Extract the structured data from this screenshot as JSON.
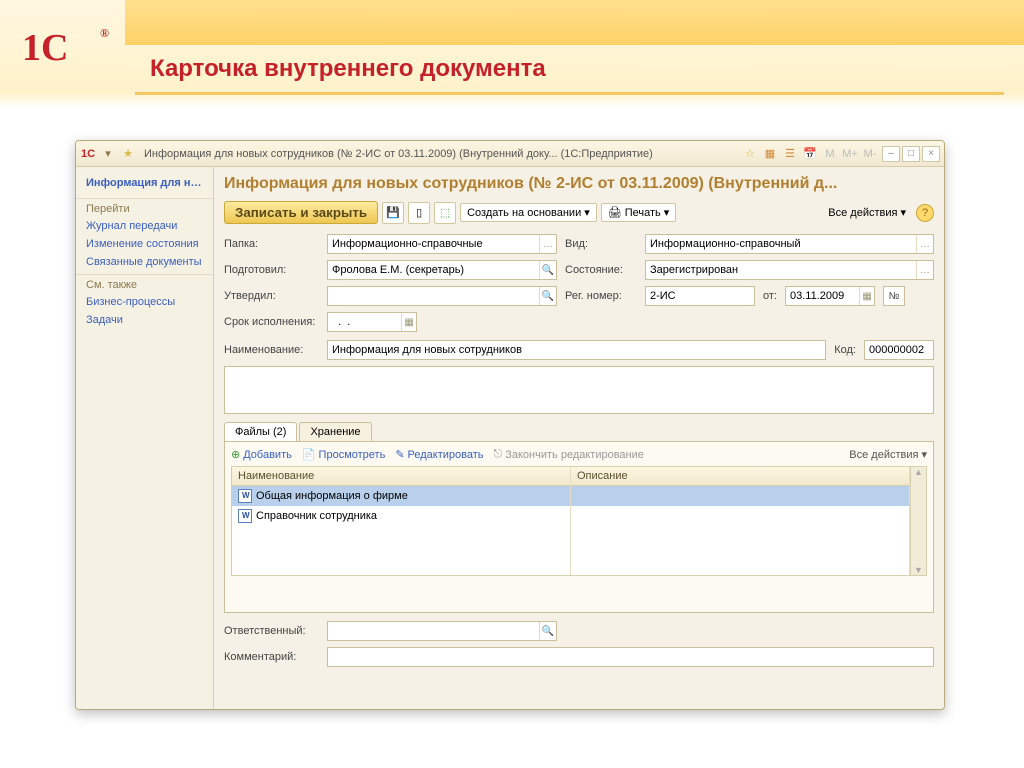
{
  "slide": {
    "title": "Карточка внутреннего документа",
    "logo_text": "1С"
  },
  "titlebar": {
    "text": "Информация для новых сотрудников (№ 2-ИС от 03.11.2009) (Внутренний доку...   (1С:Предприятие)",
    "ctrls": {
      "m": "M",
      "mplus": "M+",
      "mminus": "M-"
    }
  },
  "nav": {
    "title": "Информация для нов…",
    "section1": "Перейти",
    "links1": [
      "Журнал передачи",
      "Изменение состояния",
      "Связанные документы"
    ],
    "section2": "См. также",
    "links2": [
      "Бизнес-процессы",
      "Задачи"
    ]
  },
  "content": {
    "title": "Информация для новых сотрудников (№ 2-ИС от 03.11.2009) (Внутренний д..."
  },
  "toolbar": {
    "save_close": "Записать и закрыть",
    "create_based": "Создать на основании",
    "print": "Печать",
    "all_actions": "Все действия"
  },
  "form": {
    "folder_lbl": "Папка:",
    "folder_val": "Информационно-справочные",
    "kind_lbl": "Вид:",
    "kind_val": "Информационно-справочный",
    "prepared_lbl": "Подготовил:",
    "prepared_val": "Фролова Е.М. (секретарь)",
    "state_lbl": "Состояние:",
    "state_val": "Зарегистрирован",
    "approved_lbl": "Утвердил:",
    "approved_val": "",
    "regnum_lbl": "Рег. номер:",
    "regnum_val": "2-ИС",
    "from_lbl": "от:",
    "from_val": "03.11.2009",
    "num_btn": "№",
    "due_lbl": "Срок исполнения:",
    "due_val": "  .  .",
    "name_lbl": "Наименование:",
    "name_val": "Информация для новых сотрудников",
    "code_lbl": "Код:",
    "code_val": "000000002",
    "resp_lbl": "Ответственный:",
    "resp_val": "",
    "comment_lbl": "Комментарий:",
    "comment_val": ""
  },
  "tabs": {
    "files": "Файлы (2)",
    "storage": "Хранение",
    "add": "Добавить",
    "view": "Просмотреть",
    "edit": "Редактировать",
    "finish_edit": "Закончить редактирование",
    "all_actions": "Все действия",
    "col_name": "Наименование",
    "col_desc": "Описание",
    "rows": [
      "Общая информация о фирме",
      "Справочник сотрудника"
    ]
  }
}
